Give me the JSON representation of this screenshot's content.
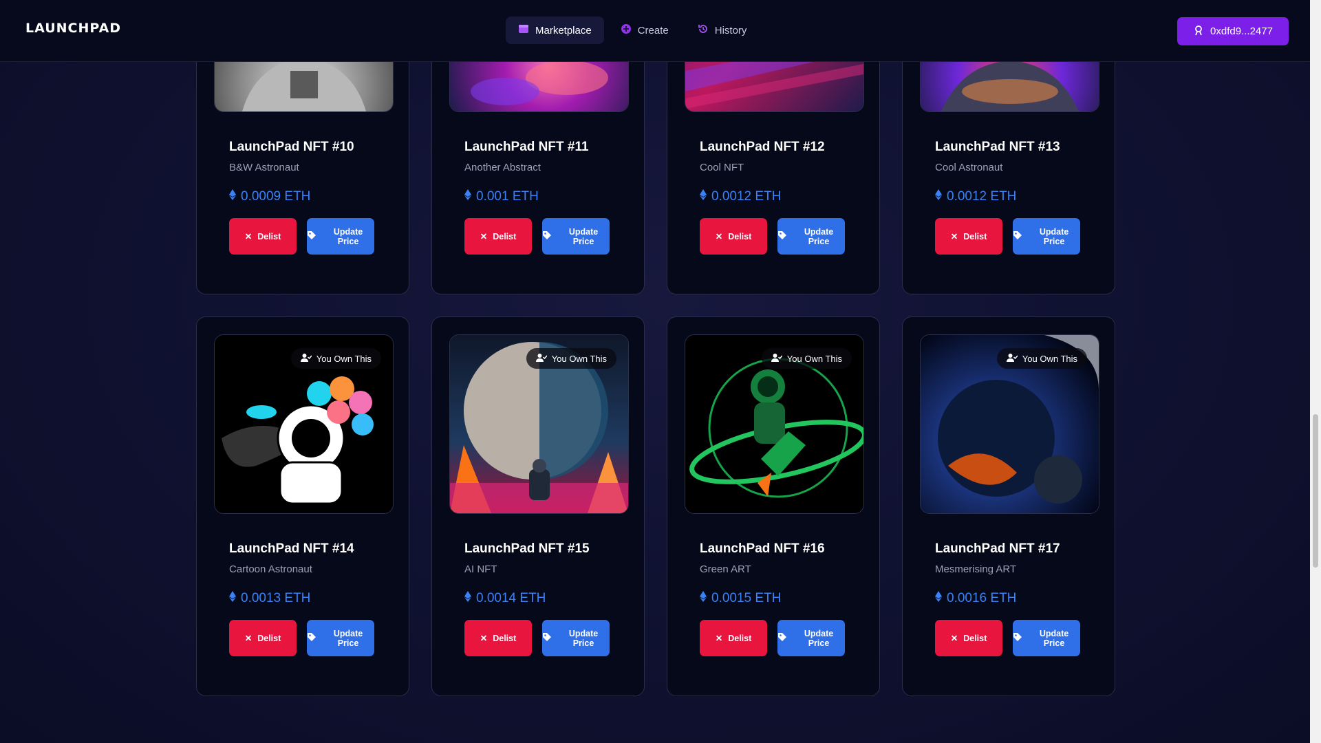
{
  "app": {
    "logo": "LAUNCHPAD"
  },
  "nav": {
    "items": [
      {
        "label": "Marketplace",
        "icon": "store-icon",
        "active": true
      },
      {
        "label": "Create",
        "icon": "plus-circle-icon",
        "active": false
      },
      {
        "label": "History",
        "icon": "history-icon",
        "active": false
      }
    ]
  },
  "wallet": {
    "label": "0xdfd9...2477",
    "icon": "user-badge-icon"
  },
  "colors": {
    "accent": "#7c1fe8",
    "delist": "#e8163f",
    "update": "#2f6fe8",
    "price": "#3b82f6"
  },
  "cards": [
    {
      "title": "LaunchPad NFT #10",
      "subtitle": "B&W Astronaut",
      "price": "0.0009 ETH",
      "delist": "Delist",
      "update": "Update Price"
    },
    {
      "title": "LaunchPad NFT #11",
      "subtitle": "Another Abstract",
      "price": "0.001 ETH",
      "delist": "Delist",
      "update": "Update Price"
    },
    {
      "title": "LaunchPad NFT #12",
      "subtitle": "Cool NFT",
      "price": "0.0012 ETH",
      "delist": "Delist",
      "update": "Update Price"
    },
    {
      "title": "LaunchPad NFT #13",
      "subtitle": "Cool Astronaut",
      "price": "0.0012 ETH",
      "delist": "Delist",
      "update": "Update Price"
    },
    {
      "title": "LaunchPad NFT #14",
      "subtitle": "Cartoon Astronaut",
      "price": "0.0013 ETH",
      "delist": "Delist",
      "update": "Update Price",
      "badge": "You Own This"
    },
    {
      "title": "LaunchPad NFT #15",
      "subtitle": "AI NFT",
      "price": "0.0014 ETH",
      "delist": "Delist",
      "update": "Update Price",
      "badge": "You Own This"
    },
    {
      "title": "LaunchPad NFT #16",
      "subtitle": "Green ART",
      "price": "0.0015 ETH",
      "delist": "Delist",
      "update": "Update Price",
      "badge": "You Own This"
    },
    {
      "title": "LaunchPad NFT #17",
      "subtitle": "Mesmerising ART",
      "price": "0.0016 ETH",
      "delist": "Delist",
      "update": "Update Price",
      "badge": "You Own This"
    }
  ]
}
